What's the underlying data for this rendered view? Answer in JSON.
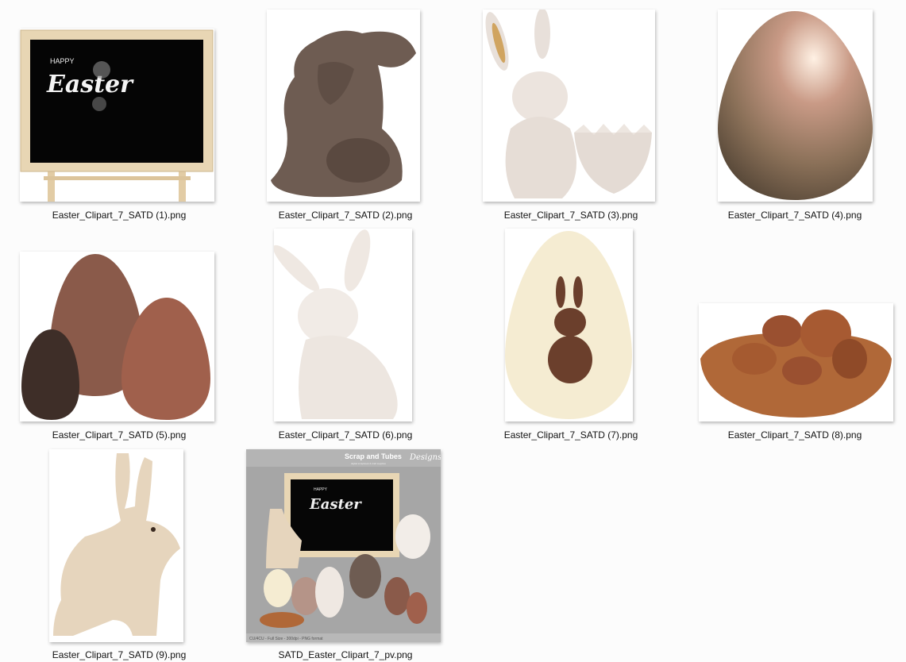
{
  "window": {
    "background": "#fcfcfc"
  },
  "files": [
    {
      "name": "Easter_Clipart_7_SATD (1).png",
      "image": "chalkboard-easel-with-happy-easter-lettering"
    },
    {
      "name": "Easter_Clipart_7_SATD (2).png",
      "image": "milk-chocolate-bunny"
    },
    {
      "name": "Easter_Clipart_7_SATD (3).png",
      "image": "ceramic-bunny-egg-cup"
    },
    {
      "name": "Easter_Clipart_7_SATD (4).png",
      "image": "metallic-painted-egg"
    },
    {
      "name": "Easter_Clipart_7_SATD (5).png",
      "image": "three-chocolate-eggs"
    },
    {
      "name": "Easter_Clipart_7_SATD (6).png",
      "image": "white-ceramic-bunny"
    },
    {
      "name": "Easter_Clipart_7_SATD (7).png",
      "image": "white-chocolate-egg-with-bunny"
    },
    {
      "name": "Easter_Clipart_7_SATD (8).png",
      "image": "chocolate-shell-with-mini-eggs"
    },
    {
      "name": "Easter_Clipart_7_SATD (9).png",
      "image": "wooden-bunny-cutout"
    },
    {
      "name": "SATD_Easter_Clipart_7_pv.png",
      "image": "kit-preview-collage"
    }
  ],
  "board_lettering": {
    "small": "HAPPY",
    "large": "Easter"
  },
  "preview": {
    "brand": "Scrap and Tubes",
    "brand_script": "Designs",
    "tagline": "digital scrapbook & craft supplies",
    "footer": "CU/4CU - Full Size - 300dpi - PNG format"
  }
}
